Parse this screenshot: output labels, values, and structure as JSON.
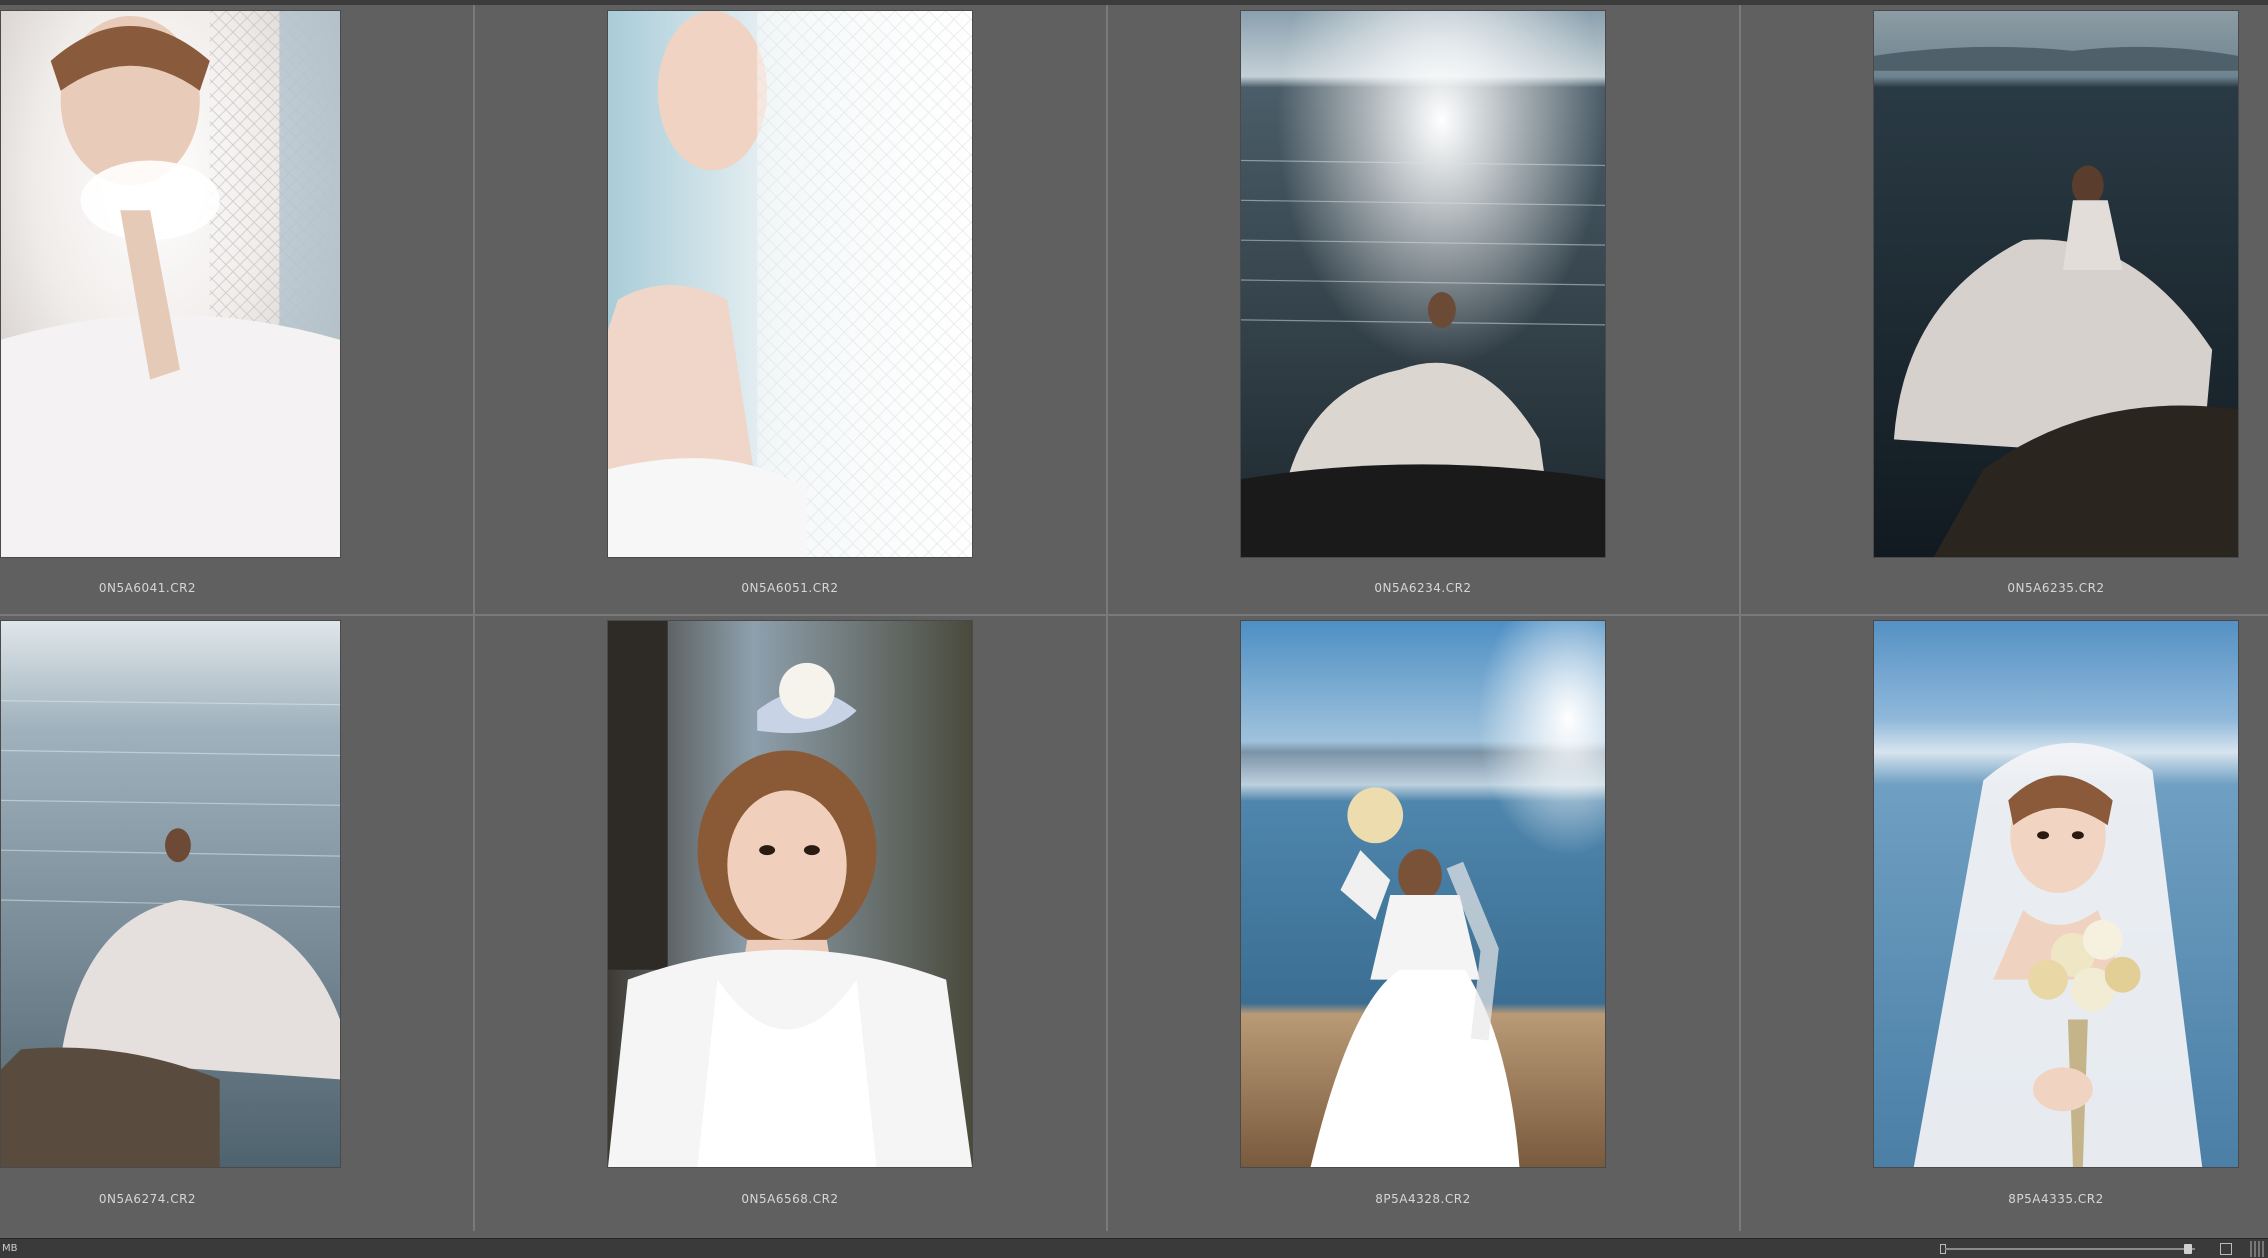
{
  "thumbnails": [
    {
      "filename": "0N5A6041.CR2",
      "scene": "portrait-veil-bright"
    },
    {
      "filename": "0N5A6051.CR2",
      "scene": "profile-veil-light"
    },
    {
      "filename": "0N5A6234.CR2",
      "scene": "bride-on-rock-sunlit-sea"
    },
    {
      "filename": "0N5A6235.CR2",
      "scene": "bride-on-rock-dark-sea"
    },
    {
      "filename": "0N5A6274.CR2",
      "scene": "bride-on-rock-waves"
    },
    {
      "filename": "0N5A6568.CR2",
      "scene": "portrait-flower-headpiece"
    },
    {
      "filename": "8P5A4328.CR2",
      "scene": "bride-bouquet-beach"
    },
    {
      "filename": "8P5A4335.CR2",
      "scene": "bride-bouquet-closeup"
    }
  ],
  "status": {
    "size_unit": "MB"
  },
  "colors": {
    "background": "#606060",
    "divider": "#7a7a7a",
    "status_bar": "#3a3a3a"
  }
}
